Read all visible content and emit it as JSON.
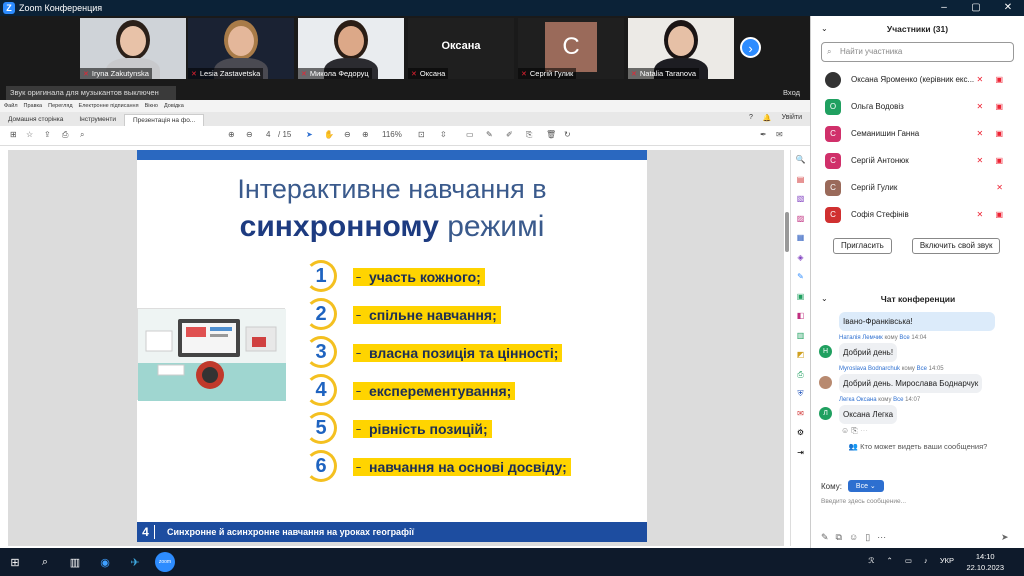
{
  "window": {
    "title": "Zoom Конференция",
    "controls": [
      "–",
      "▢",
      "✕"
    ]
  },
  "participants_strip": [
    {
      "name": "Iryna Zakutynska",
      "bg": "#cfd3d8",
      "skin": "#e8c2a8",
      "hair": "#2b2019",
      "shirt": "#c8c9cc"
    },
    {
      "name": "Lesia Zastavetska",
      "bg": "#1a2233",
      "skin": "#e4b79a",
      "hair": "#a87b48",
      "shirt": "#4a4a52"
    },
    {
      "name": "Микола Федоруц",
      "bg": "#e9ecef",
      "skin": "#dca888",
      "hair": "#2a1d15",
      "shirt": "#2b2b30"
    },
    {
      "name": "Оксана",
      "bg": "#1f1f1f",
      "label": "Оксана"
    },
    {
      "name": "Сергій Гулик",
      "bg": "#1f1f1f",
      "initial": "С",
      "initial_bg": "#9a6a5a"
    },
    {
      "name": "Natalia Taranova",
      "bg": "#eceae6",
      "skin": "#e6c0a6",
      "hair": "#1a1414",
      "shirt": "#1d1d22"
    }
  ],
  "notice": "Звук оригинала для музыкантов выключен",
  "enter_label": "Вход",
  "app": {
    "menu": [
      "Файл",
      "Правка",
      "Перегляд",
      "Електронне підписання",
      "Вікно",
      "Довідка"
    ],
    "tabs": [
      "Домашня сторінка",
      "Інструменти",
      "Презентація на фо..."
    ],
    "sign_in": "Увійти",
    "page_current": "4",
    "page_total": "/ 15",
    "zoom": "116%"
  },
  "slide": {
    "title_line1": "Інтерактивне навчання в",
    "title_bold": "синхронному",
    "title_rest": " режимі",
    "items": [
      {
        "n": "1",
        "text": "участь кожного;"
      },
      {
        "n": "2",
        "text": "спільне навчання;"
      },
      {
        "n": "3",
        "text": "власна позиція та цінності;"
      },
      {
        "n": "4",
        "text": "експерементування;"
      },
      {
        "n": "5",
        "text": "рівність позицій;"
      },
      {
        "n": "6",
        "text": "навчання на основі досвіду;"
      }
    ],
    "footer_num": "4",
    "footer_text": "Синхронне й асинхронне навчання на уроках географії"
  },
  "panel": {
    "participants_title": "Участники (31)",
    "search_placeholder": "Найти участника",
    "list": [
      {
        "name": "Оксана Яроменко (керівник екс...",
        "initial": "",
        "color": "#333",
        "icons": "✕ ▣"
      },
      {
        "name": "Ольга Водовіз",
        "initial": "О",
        "color": "#20a060",
        "icons": "✕ ▣"
      },
      {
        "name": "Семанишин Ганна",
        "initial": "С",
        "color": "#d0306a",
        "icons": "✕ ▣"
      },
      {
        "name": "Сергій Антонюк",
        "initial": "С",
        "color": "#d0306a",
        "icons": "✕ ▣"
      },
      {
        "name": "Сергій Гулик",
        "initial": "С",
        "color": "#9a6a5a",
        "icons": "✕"
      },
      {
        "name": "Софія Стефінів",
        "initial": "С",
        "color": "#d03030",
        "icons": "✕ ▣"
      }
    ],
    "invite": "Пригласить",
    "unmute": "Включить свой звук",
    "chat_title": "Чат конференции",
    "messages": [
      {
        "sender": "",
        "to": "",
        "time": "",
        "text": "Івано-Франківська!",
        "initial": "",
        "color": ""
      },
      {
        "sender": "Наталія Лемчик",
        "to": "Все",
        "time": "14:04",
        "text": "Добрий день!",
        "initial": "Н",
        "color": "#20a060"
      },
      {
        "sender": "Myroslava Bodnarchuk",
        "to": "Все",
        "time": "14:05",
        "text": "Добрий день. Мирослава Боднарчук",
        "initial": "",
        "color": "#b88a70"
      },
      {
        "sender": "Легка Оксана",
        "to": "Все",
        "time": "14:07",
        "text": "Оксана Легка",
        "initial": "Л",
        "color": "#20a060"
      }
    ],
    "to_word": "кому",
    "who_can_see": "Кто может видеть ваши сообщения?",
    "recipient_label": "Кому:",
    "recipient_value": "Все",
    "input_placeholder": "Введите здесь сообщение..."
  },
  "taskbar": {
    "lang": "УКР",
    "time": "14:10",
    "date": "22.10.2023",
    "zoom_label": "zoom"
  }
}
